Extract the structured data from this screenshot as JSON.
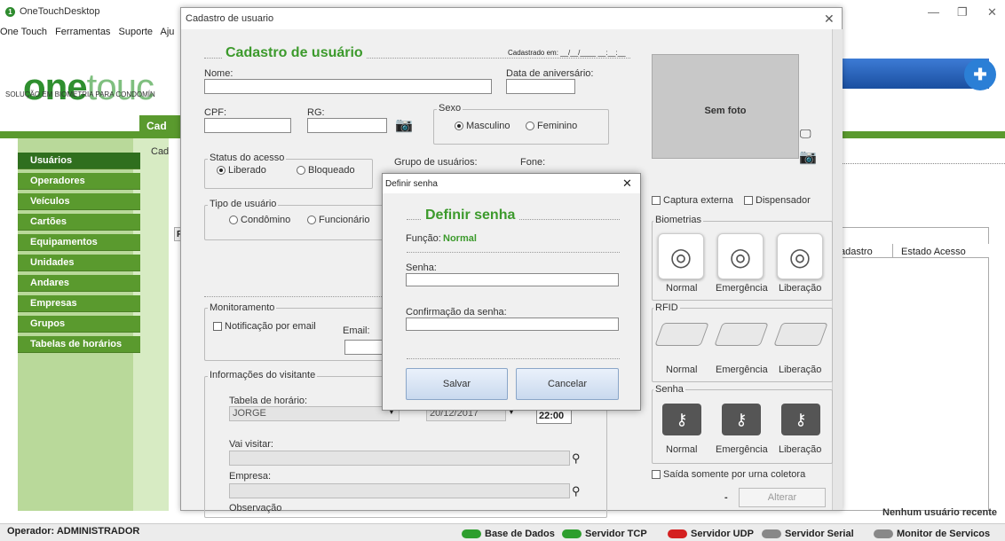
{
  "app": {
    "title": "OneTouchDesktop",
    "menu": [
      "One Touch",
      "Ferramentas",
      "Suporte",
      "Aju"
    ]
  },
  "logo": {
    "part1": "one",
    "part2": "touc",
    "subtitle": "SOLUÇÃO EM BIOMETRIA PARA CONDOMÍN"
  },
  "tab": {
    "label": "Cad"
  },
  "sidebar": {
    "items": [
      "Usuários",
      "Operadores",
      "Veículos",
      "Cartões",
      "Equipamentos",
      "Unidades",
      "Andares",
      "Empresas",
      "Grupos",
      "Tabelas de horários"
    ]
  },
  "background": {
    "cad_label": "Cad",
    "r_tab": "R",
    "col_cadastro": "adastro",
    "col_estado": "Estado Acesso",
    "nenhum": "Nenhum usuário recente"
  },
  "statusbar": {
    "operador": "Operador: ADMINISTRADOR",
    "services": [
      {
        "label": "Base de Dados",
        "color": "#2e9e2e"
      },
      {
        "label": "Servidor TCP",
        "color": "#2e9e2e"
      },
      {
        "label": "Servidor UDP",
        "color": "#d42020"
      },
      {
        "label": "Servidor Serial",
        "color": "#888888"
      },
      {
        "label": "Monitor de Servicos",
        "color": "#888888"
      }
    ]
  },
  "cadastro": {
    "window_title": "Cadastro de usuario",
    "heading": "Cadastro de usuário",
    "cadastrado_em": "Cadastrado em: __/__/____ __:__:__",
    "nome_label": "Nome:",
    "data_aniv_label": "Data de aniversário:",
    "cpf_label": "CPF:",
    "rg_label": "RG:",
    "sexo_title": "Sexo",
    "sexo_opts": [
      "Masculino",
      "Feminino"
    ],
    "status_title": "Status do acesso",
    "status_opts": [
      "Liberado",
      "Bloqueado"
    ],
    "grupo_label": "Grupo de usuários:",
    "fone_label": "Fone:",
    "tipo_title": "Tipo de usuário",
    "tipo_opts": [
      "Condômino",
      "Funcionário"
    ],
    "monit_title": "Monitoramento",
    "notif_label": "Notificação por email",
    "email_label": "Email:",
    "visitante_title": "Informações do visitante",
    "tabela_label": "Tabela de horário:",
    "tabela_value": "JORGE",
    "data_value": "20/12/2017",
    "hora_value": "22:00",
    "vai_visitar_label": "Vai visitar:",
    "empresa_label": "Empresa:",
    "obs_label": "Observação",
    "sem_foto": "Sem foto",
    "captura_label": "Captura externa",
    "dispensador_label": "Dispensador",
    "biometrias_title": "Biometrias",
    "rfid_title": "RFID",
    "senha_title": "Senha",
    "bio_labels": [
      "Normal",
      "Emergência",
      "Liberação"
    ],
    "saida_label": "Saída somente por urna coletora",
    "dash": "-",
    "alterar": "Alterar"
  },
  "senha": {
    "window_title": "Definir senha",
    "heading": "Definir senha",
    "funcao_label": "Função:",
    "funcao_value": "Normal",
    "senha_label": "Senha:",
    "confirm_label": "Confirmação da senha:",
    "salvar": "Salvar",
    "cancelar": "Cancelar"
  }
}
